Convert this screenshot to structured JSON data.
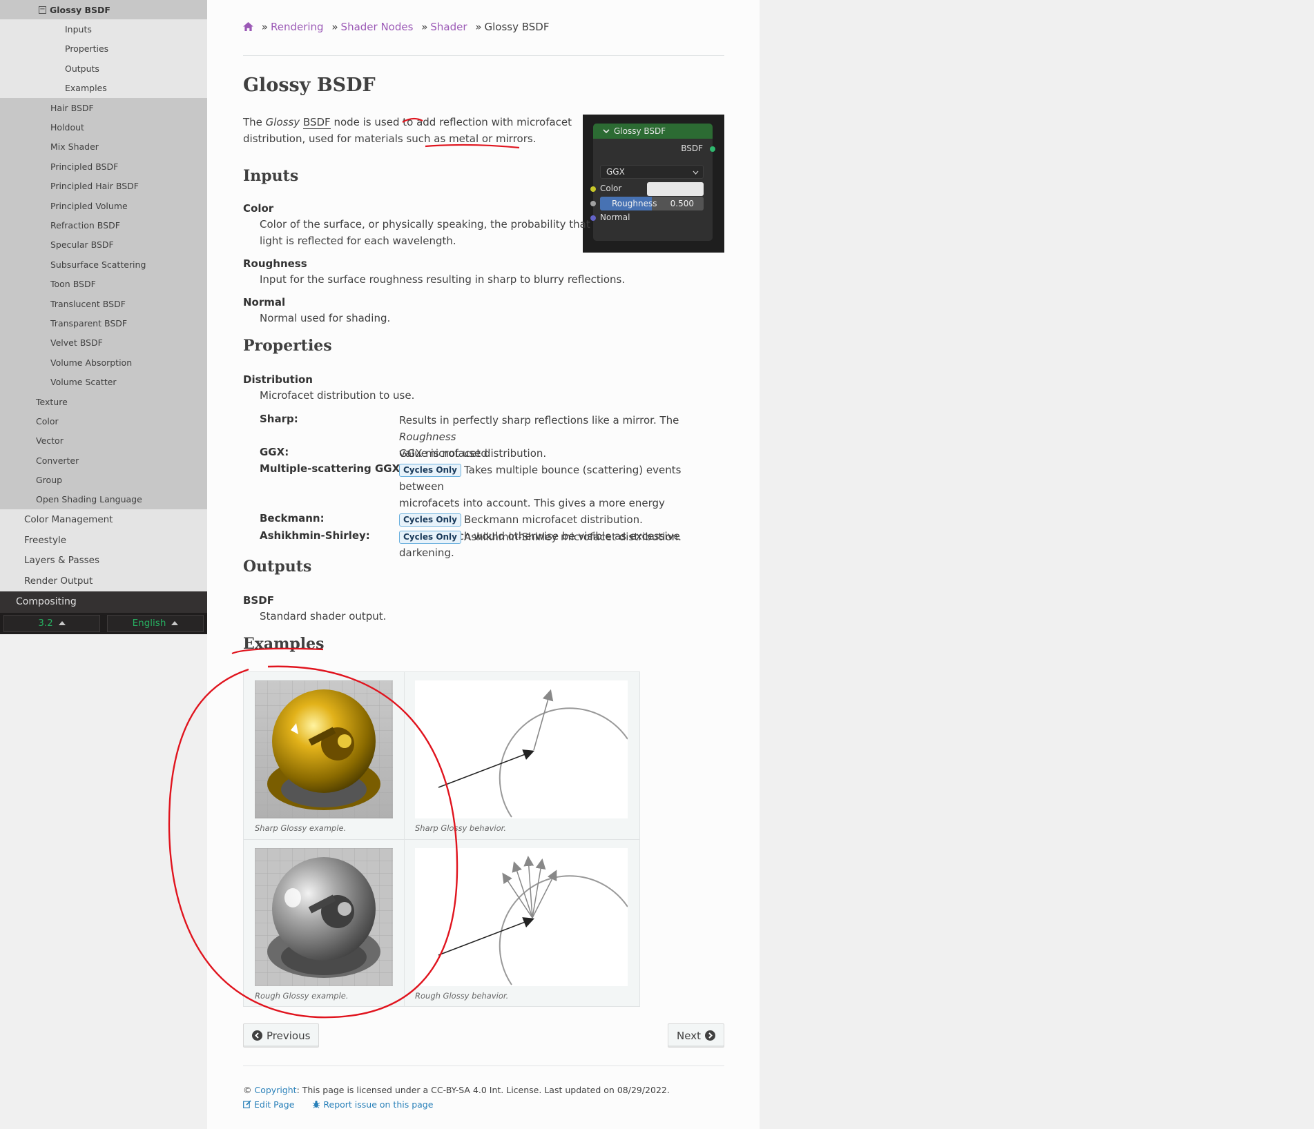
{
  "sidebar": {
    "current": {
      "label": "Glossy BSDF"
    },
    "current_children": [
      {
        "label": "Inputs"
      },
      {
        "label": "Properties"
      },
      {
        "label": "Outputs"
      },
      {
        "label": "Examples"
      }
    ],
    "shader_siblings": [
      {
        "label": "Hair BSDF"
      },
      {
        "label": "Holdout"
      },
      {
        "label": "Mix Shader"
      },
      {
        "label": "Principled BSDF"
      },
      {
        "label": "Principled Hair BSDF"
      },
      {
        "label": "Principled Volume"
      },
      {
        "label": "Refraction BSDF"
      },
      {
        "label": "Specular BSDF"
      },
      {
        "label": "Subsurface Scattering"
      },
      {
        "label": "Toon BSDF"
      },
      {
        "label": "Translucent BSDF"
      },
      {
        "label": "Transparent BSDF"
      },
      {
        "label": "Velvet BSDF"
      },
      {
        "label": "Volume Absorption"
      },
      {
        "label": "Volume Scatter"
      }
    ],
    "node_categories": [
      {
        "label": "Texture"
      },
      {
        "label": "Color"
      },
      {
        "label": "Vector"
      },
      {
        "label": "Converter"
      },
      {
        "label": "Group"
      },
      {
        "label": "Open Shading Language"
      }
    ],
    "rendering_sections": [
      {
        "label": "Color Management"
      },
      {
        "label": "Freestyle"
      },
      {
        "label": "Layers & Passes"
      },
      {
        "label": "Render Output"
      }
    ],
    "top_section": {
      "label": "Compositing"
    },
    "version": "3.2",
    "language": "English"
  },
  "breadcrumb": {
    "items": [
      "Rendering",
      "Shader Nodes",
      "Shader"
    ],
    "separator": "»",
    "current": "Glossy BSDF"
  },
  "page": {
    "title": "Glossy BSDF",
    "intro": {
      "p1": "The ",
      "em": "Glossy",
      "p2": " ",
      "bsdf": "BSDF",
      "p3": " node is used to ",
      "add": "add",
      "p4": " reflection with microfacet",
      "line2a": "distribution, used for materials such as ",
      "line2b": "metal or mirrors."
    },
    "inputs": {
      "heading": "Inputs",
      "items": [
        {
          "term": "Color",
          "def1": "Color of the surface, or physically speaking, the probability that",
          "def2": "light is reflected for each wavelength."
        },
        {
          "term": "Roughness",
          "def1": "Input for the surface roughness resulting in sharp to blurry reflections."
        },
        {
          "term": "Normal",
          "def1": "Normal used for shading."
        }
      ]
    },
    "properties": {
      "heading": "Properties",
      "term": "Distribution",
      "def": "Microfacet distribution to use.",
      "options": [
        {
          "term": "Sharp:",
          "line1a": "Results in perfectly sharp reflections like a mirror. The ",
          "line1em": "Roughness",
          "line2": "value is not used."
        },
        {
          "term": "GGX:",
          "line1": "GGX microfacet distribution."
        },
        {
          "term": "Multiple-scattering GGX:",
          "badge": "Cycles Only",
          "line1": "Takes multiple bounce (scattering) events between",
          "line2": "microfacets into account. This gives a more energy conserving",
          "line3": "results, which would otherwise be visible as excessive darkening."
        },
        {
          "term": "Beckmann:",
          "badge": "Cycles Only",
          "line1": "Beckmann microfacet distribution."
        },
        {
          "term": "Ashikhmin-Shirley:",
          "badge": "Cycles Only",
          "line1": "Ashikhmin-Shirley microfacet distribution."
        }
      ]
    },
    "outputs": {
      "heading": "Outputs",
      "term": "BSDF",
      "def": "Standard shader output."
    },
    "examples": {
      "heading": "Examples",
      "captions": [
        "Sharp Glossy example.",
        "Sharp Glossy behavior.",
        "Rough Glossy example.",
        "Rough Glossy behavior."
      ]
    }
  },
  "node_ui": {
    "header": "Glossy BSDF",
    "output_socket": "BSDF",
    "distribution": "GGX",
    "color_label": "Color",
    "roughness_label": "Roughness",
    "roughness_value": "0.500",
    "roughness_fraction": 0.5,
    "normal_label": "Normal",
    "header_color": "#2c6b33",
    "slider_color": "#4772b3"
  },
  "nav": {
    "previous": "Previous",
    "next": "Next"
  },
  "footer": {
    "copyright_symbol": "©",
    "copyright_link": "Copyright",
    "license": ": This page is licensed under a CC-BY-SA 4.0 Int. License. Last updated on 08/29/2022.",
    "edit": "Edit Page",
    "report": "Report issue on this page"
  },
  "colors": {
    "link": "#9b59b6",
    "footer_link": "#2980b9",
    "annotation": "#e0141e",
    "version_text": "#27ae60"
  }
}
